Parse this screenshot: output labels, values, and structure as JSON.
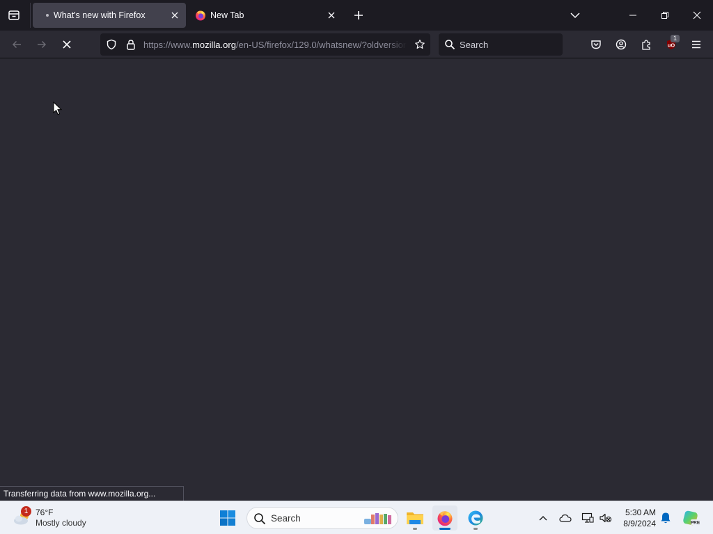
{
  "tabs": [
    {
      "title": "What's new with Firefox",
      "active": true,
      "loading": true
    },
    {
      "title": "New Tab",
      "active": false
    }
  ],
  "navbar": {
    "url_scheme": "https://www.",
    "url_host": "mozilla.org",
    "url_path": "/en-US/firefox/129.0/whatsnew/?oldversion=",
    "search_placeholder": "Search",
    "extension_badge": "1"
  },
  "status_text": "Transferring data from www.mozilla.org...",
  "taskbar": {
    "weather_temp": "76°F",
    "weather_condition": "Mostly cloudy",
    "weather_badge": "1",
    "search_placeholder": "Search",
    "time": "5:30 AM",
    "date": "8/9/2024"
  },
  "colors": {
    "tabstrip_bg": "#1c1b22",
    "toolbar_bg": "#2b2a33",
    "active_tab_bg": "#42414d",
    "taskbar_bg": "#eef1f7",
    "accent": "#0067c0"
  }
}
